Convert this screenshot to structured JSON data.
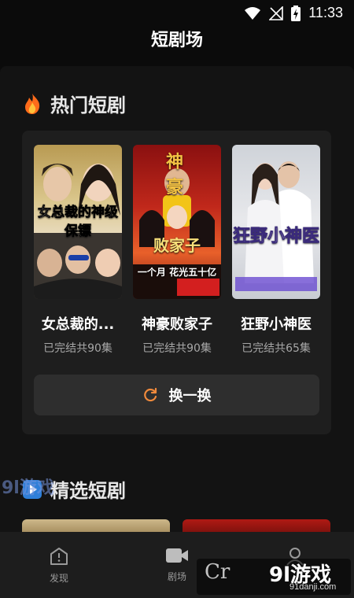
{
  "status": {
    "time": "11:33"
  },
  "header": {
    "title": "短剧场"
  },
  "hot_section": {
    "title": "热门短剧",
    "dramas": [
      {
        "title": "女总裁的...",
        "subtitle": "已完结共90集",
        "poster_text": "女总裁的神级保镖"
      },
      {
        "title": "神豪败家子",
        "subtitle": "已完结共90集",
        "poster_text_top": "神豪",
        "poster_text_mid": "败家子",
        "poster_text_bottom": "一个月 花光五十亿"
      },
      {
        "title": "狂野小神医",
        "subtitle": "已完结共65集",
        "poster_text": "狂野小神医"
      }
    ],
    "refresh_label": "换一换"
  },
  "featured_section": {
    "title": "精选短剧"
  },
  "tabs": [
    {
      "label": "发现"
    },
    {
      "label": "剧场"
    },
    {
      "label": ""
    }
  ],
  "watermark": {
    "logo": "9l游戏",
    "site": "91danji.com",
    "left_logo": "9l游戏"
  },
  "colors": {
    "accent": "#f08a3c",
    "flame": "#ff7a1c"
  }
}
